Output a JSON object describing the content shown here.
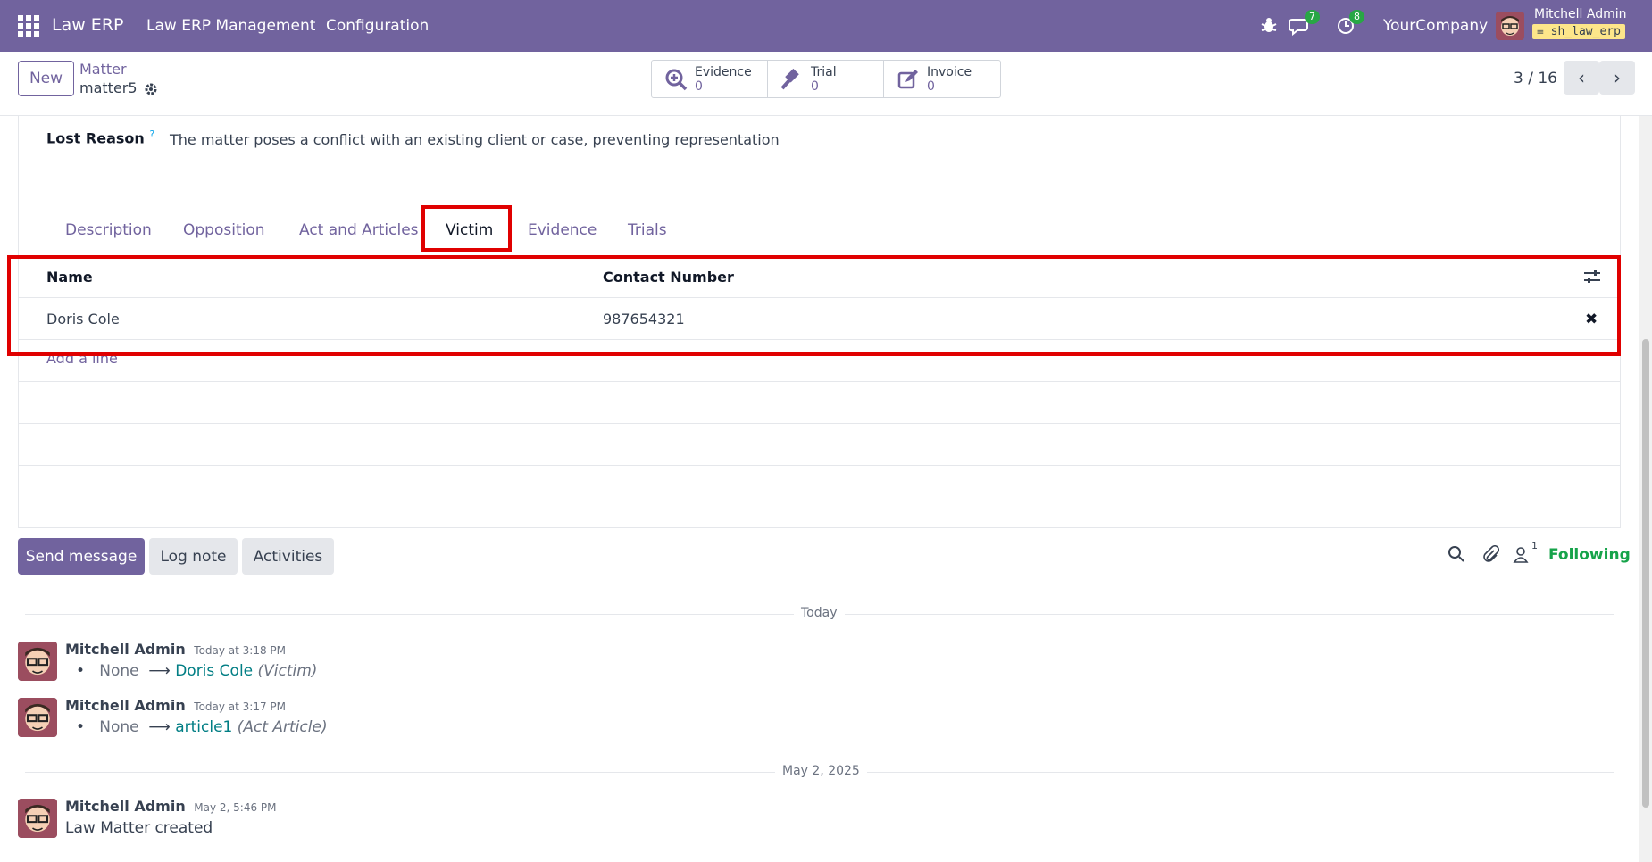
{
  "navbar": {
    "brand": "Law ERP",
    "menus": [
      "Law ERP Management",
      "Configuration"
    ],
    "chat_badge": "7",
    "activity_badge": "8",
    "company": "YourCompany",
    "user_name": "Mitchell Admin",
    "database": "sh_law_erp"
  },
  "control": {
    "new_label": "New",
    "breadcrumb_parent": "Matter",
    "breadcrumb_current": "matter5",
    "smart_buttons": [
      {
        "label": "Evidence",
        "count": "0",
        "icon": "search-plus-icon"
      },
      {
        "label": "Trial",
        "count": "0",
        "icon": "gavel-icon"
      },
      {
        "label": "Invoice",
        "count": "0",
        "icon": "pencil-square-icon"
      }
    ],
    "pager": "3 / 16"
  },
  "form": {
    "lost_reason_label": "Lost Reason",
    "lost_reason_help": "?",
    "lost_reason_value": "The matter poses a conflict with an existing client or case, preventing representation",
    "tabs": [
      "Description",
      "Opposition",
      "Act and Articles",
      "Victim",
      "Evidence",
      "Trials"
    ],
    "active_tab": "Victim",
    "victim_table": {
      "columns": [
        "Name",
        "Contact Number"
      ],
      "rows": [
        {
          "name": "Doris Cole",
          "contact": "987654321"
        }
      ],
      "add_line": "Add a line"
    }
  },
  "chatter": {
    "send_message": "Send message",
    "log_note": "Log note",
    "activities": "Activities",
    "followers_count": "1",
    "following": "Following",
    "groups": [
      {
        "date": "Today",
        "messages": [
          {
            "author": "Mitchell Admin",
            "time": "Today at 3:18 PM",
            "old": "None",
            "new": "Doris Cole",
            "field": "(Victim)"
          },
          {
            "author": "Mitchell Admin",
            "time": "Today at 3:17 PM",
            "old": "None",
            "new": "article1",
            "field": "(Act Article)"
          }
        ]
      },
      {
        "date": "May 2, 2025",
        "messages": [
          {
            "author": "Mitchell Admin",
            "time": "May 2, 5:46 PM",
            "body": "Law Matter created"
          }
        ]
      }
    ]
  },
  "colors": {
    "brand": "#71639e",
    "highlight": "#e00000",
    "following": "#16a34a",
    "link": "#017e84"
  }
}
